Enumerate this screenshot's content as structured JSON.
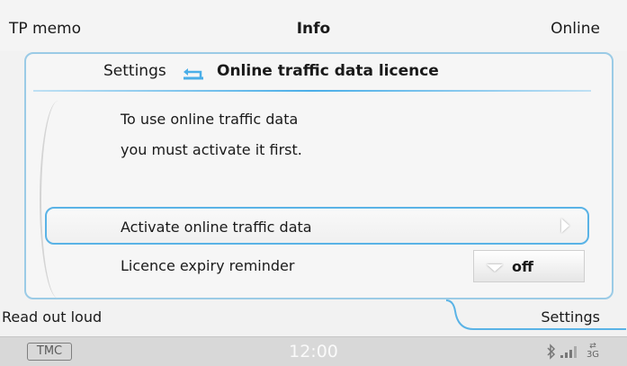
{
  "header": {
    "left": "TP memo",
    "center": "Info",
    "right": "Online"
  },
  "panel": {
    "breadcrumb": "Settings",
    "title": "Online traffic data licence",
    "description": [
      "To use online traffic data",
      "you must activate it first."
    ],
    "items": [
      {
        "label": "Activate online traffic data",
        "icon": "chevron-right-icon"
      },
      {
        "label": "Licence expiry reminder",
        "value": "off",
        "icon": "dropdown-arrow-icon"
      }
    ]
  },
  "footer": {
    "left": "Read out loud",
    "right": "Settings"
  },
  "status": {
    "tmc": "TMC",
    "clock": "12:00",
    "network": "3G",
    "icons": [
      "bluetooth-icon",
      "signal-icon",
      "network-3g-icon"
    ]
  },
  "colors": {
    "accent": "#4aaee8",
    "border": "#9bcbe6"
  }
}
